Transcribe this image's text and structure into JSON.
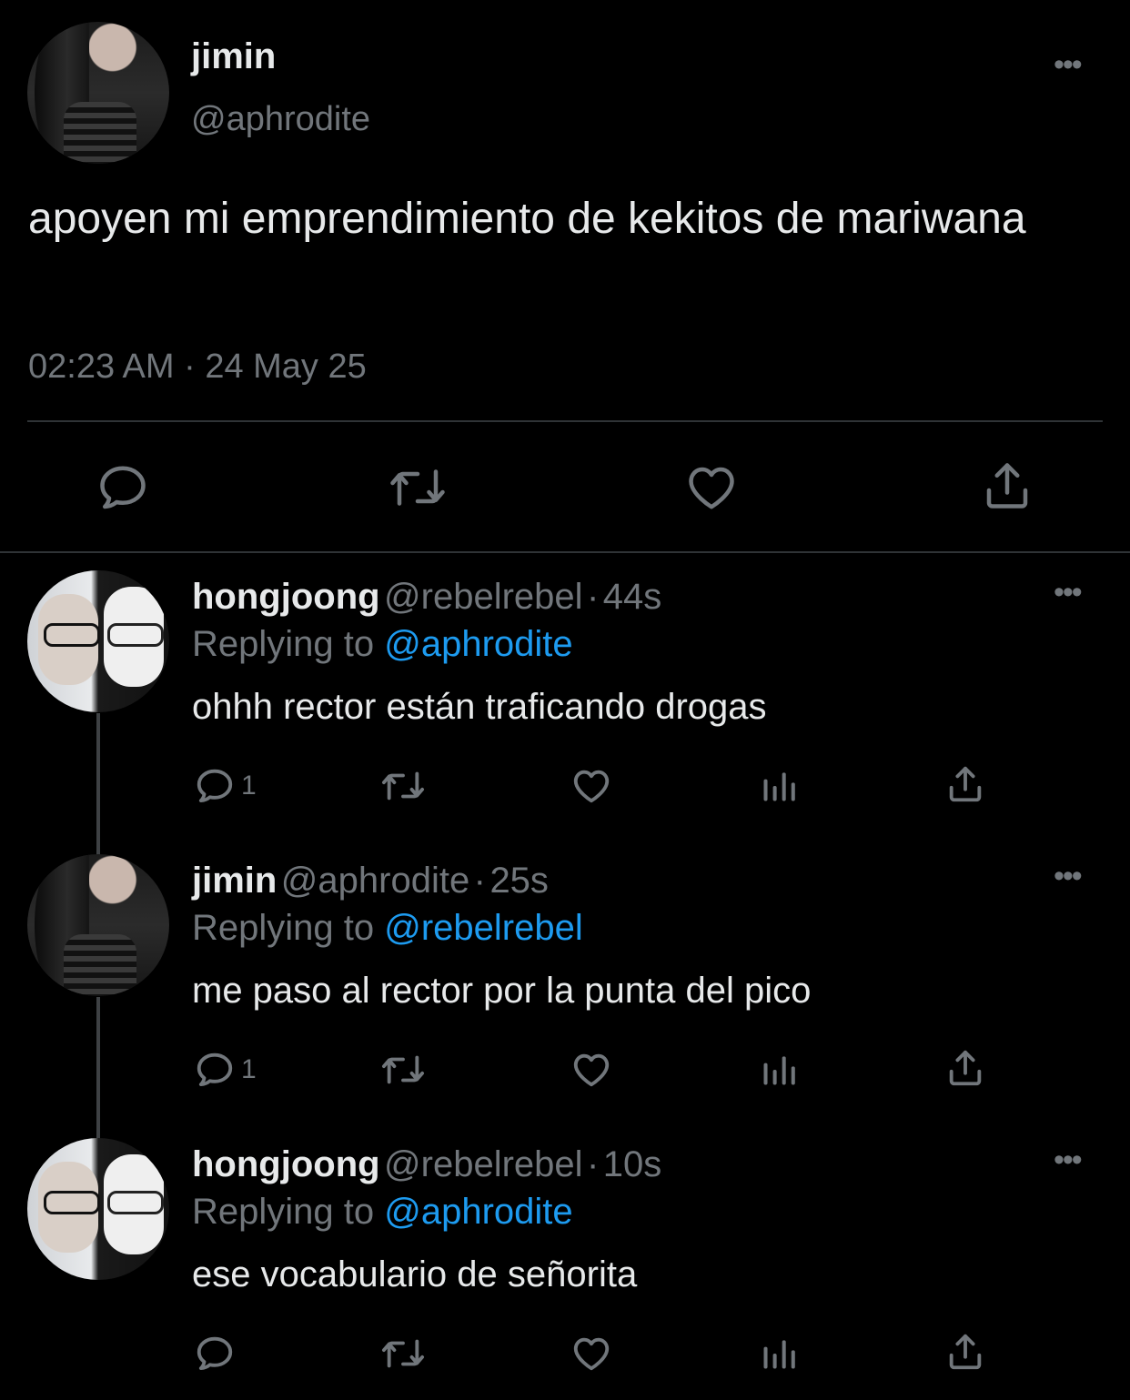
{
  "main_tweet": {
    "name": "jimin",
    "handle": "@aphrodite",
    "text": "apoyen mi emprendimiento de kekitos de mariwana",
    "timestamp": "02:23 AM · 24 May 25",
    "more_label": "•••",
    "actions": [
      "reply-icon",
      "retweet-icon",
      "like-icon",
      "share-icon"
    ]
  },
  "replies": [
    {
      "name": "hongjoong",
      "handle": "@rebelrebel",
      "sep": "·",
      "time": "44s",
      "replying_label": "Replying to",
      "replying_to": "@aphrodite",
      "text": "ohhh rector están traficando drogas",
      "reply_count": "1",
      "more_label": "•••"
    },
    {
      "name": "jimin",
      "handle": "@aphrodite",
      "sep": "·",
      "time": "25s",
      "replying_label": "Replying to",
      "replying_to": "@rebelrebel",
      "text": "me paso al rector por la punta del pico",
      "reply_count": "1",
      "more_label": "•••"
    },
    {
      "name": "hongjoong",
      "handle": "@rebelrebel",
      "sep": "·",
      "time": "10s",
      "replying_label": "Replying to",
      "replying_to": "@aphrodite",
      "text": "ese vocabulario de señorita",
      "reply_count": "",
      "more_label": "•••"
    }
  ],
  "colors": {
    "background": "#000000",
    "text": "#e7e9ea",
    "muted": "#71767b",
    "link": "#1d9bf0",
    "divider": "#2f3336"
  }
}
